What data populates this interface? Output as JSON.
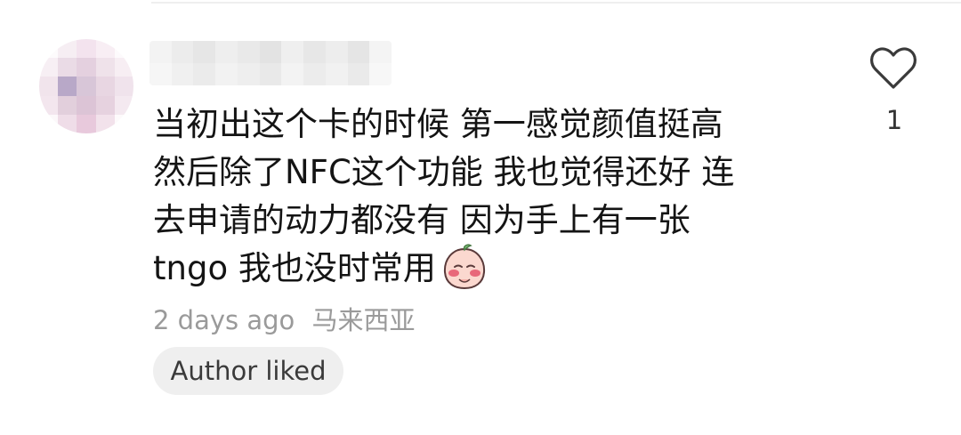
{
  "comment": {
    "lines": [
      "当初出这个卡的时候 第一感觉颜值挺高",
      "然后除了NFC这个功能 我也觉得还好 连",
      "去申请的动力都没有 因为手上有一张",
      "tngo 我也没时常用"
    ],
    "sticker_icon": "blushing-peach-sticker-icon"
  },
  "meta": {
    "time": "2 days ago",
    "location": "马来西亚"
  },
  "badge": {
    "label": "Author liked"
  },
  "like": {
    "icon": "heart-outline-icon",
    "count": "1"
  },
  "colors": {
    "text": "#141414",
    "muted": "#9a9a9a",
    "badge_bg": "#efefef"
  }
}
